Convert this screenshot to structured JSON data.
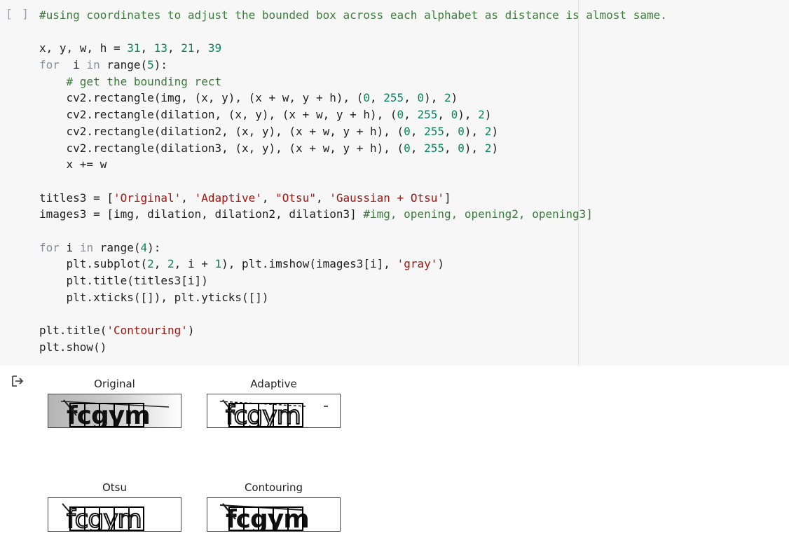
{
  "cell": {
    "run_label": "[ ]",
    "code_lines": [
      "#using coordinates to adjust the bounded box across each alphabet as distance is almost same.",
      "",
      "x, y, w, h = 31, 13, 21, 39",
      "for  i in range(5):",
      "    # get the bounding rect",
      "    cv2.rectangle(img, (x, y), (x + w, y + h), (0, 255, 0), 2)",
      "    cv2.rectangle(dilation, (x, y), (x + w, y + h), (0, 255, 0), 2)",
      "    cv2.rectangle(dilation2, (x, y), (x + w, y + h), (0, 255, 0), 2)",
      "    cv2.rectangle(dilation3, (x, y), (x + w, y + h), (0, 255, 0), 2)",
      "    x += w",
      "",
      "titles3 = ['Original', 'Adaptive', \"Otsu\", 'Gaussian + Otsu']",
      "images3 = [img, dilation, dilation2, dilation3] #img, opening, opening2, opening3]",
      "",
      "for i in range(4):",
      "    plt.subplot(2, 2, i + 1), plt.imshow(images3[i], 'gray')",
      "    plt.title(titles3[i])",
      "    plt.xticks([]), plt.yticks([])",
      "",
      "plt.title('Contouring')",
      "plt.show()"
    ]
  },
  "output": {
    "icon": "output-arrow-icon",
    "subplots": [
      {
        "title": "Original",
        "captcha_text": "fcgym",
        "variant": "gray"
      },
      {
        "title": "Adaptive",
        "captcha_text": "fcgym",
        "variant": "white"
      },
      {
        "title": "Otsu",
        "captcha_text": "fcgym",
        "variant": "white"
      },
      {
        "title": "Contouring",
        "captcha_text": "fcgym",
        "variant": "white"
      }
    ]
  }
}
